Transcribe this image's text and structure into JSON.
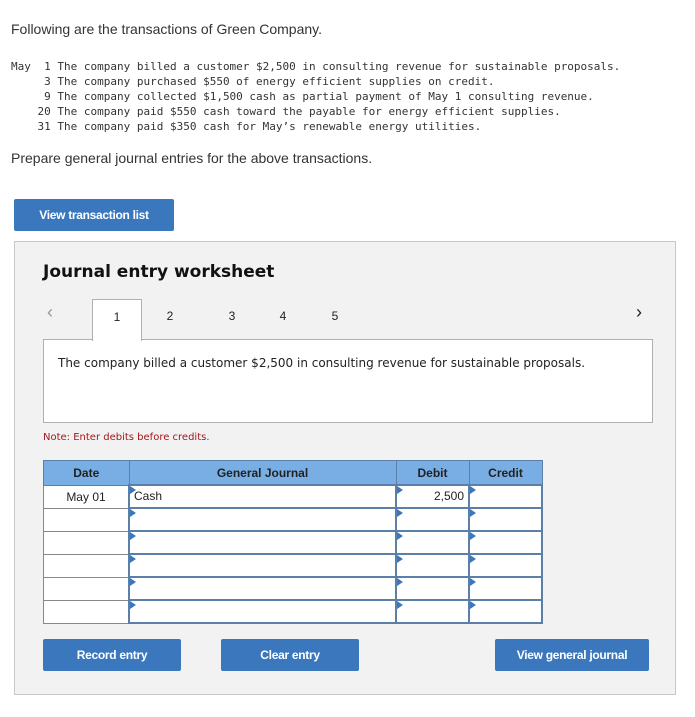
{
  "intro": "Following are the transactions of Green Company.",
  "transactions": [
    {
      "day": "May  1",
      "text": "The company billed a customer $2,500 in consulting revenue for sustainable proposals."
    },
    {
      "day": "     3",
      "text": "The company purchased $550 of energy efficient supplies on credit."
    },
    {
      "day": "     9",
      "text": "The company collected $1,500 cash as partial payment of May 1 consulting revenue."
    },
    {
      "day": "    20",
      "text": "The company paid $550 cash toward the payable for energy efficient supplies."
    },
    {
      "day": "    31",
      "text": "The company paid $350 cash for May’s renewable energy utilities."
    }
  ],
  "prompt": "Prepare general journal entries for the above transactions.",
  "buttons": {
    "view_transaction_list": "View transaction list",
    "record_entry": "Record entry",
    "clear_entry": "Clear entry",
    "view_general_journal": "View general journal"
  },
  "worksheet": {
    "title": "Journal entry worksheet",
    "nav_prev": "‹",
    "nav_next": "›",
    "tabs": [
      "1",
      "2",
      "3",
      "4",
      "5"
    ],
    "active_tab": "1",
    "description": "The company billed a customer $2,500 in consulting revenue for sustainable proposals.",
    "note": "Note: Enter debits before credits.",
    "table": {
      "headers": [
        "Date",
        "General Journal",
        "Debit",
        "Credit"
      ],
      "rows": [
        {
          "date": "May 01",
          "account": "Cash",
          "debit": "2,500",
          "credit": ""
        },
        {
          "date": "",
          "account": "",
          "debit": "",
          "credit": ""
        },
        {
          "date": "",
          "account": "",
          "debit": "",
          "credit": ""
        },
        {
          "date": "",
          "account": "",
          "debit": "",
          "credit": ""
        },
        {
          "date": "",
          "account": "",
          "debit": "",
          "credit": ""
        },
        {
          "date": "",
          "account": "",
          "debit": "",
          "credit": ""
        }
      ]
    }
  }
}
